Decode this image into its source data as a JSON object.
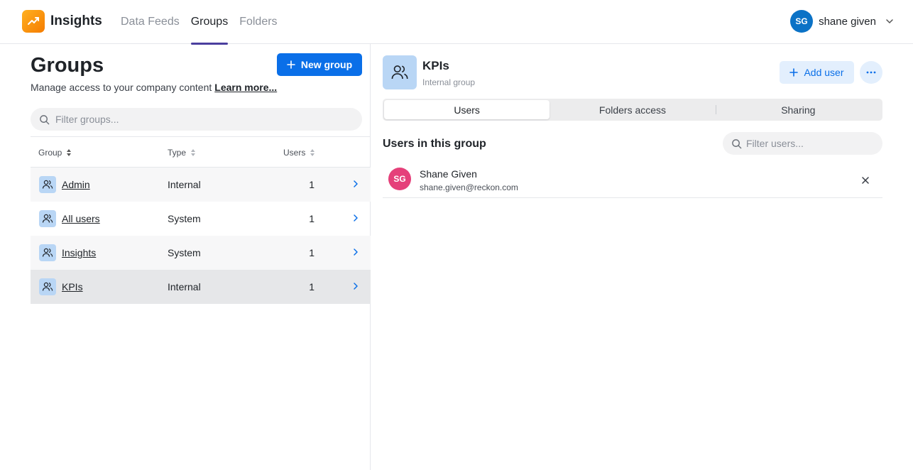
{
  "app": {
    "name": "Insights",
    "brand_color": "#f57c00"
  },
  "nav": {
    "tabs": [
      {
        "label": "Data Feeds"
      },
      {
        "label": "Groups",
        "active": true
      },
      {
        "label": "Folders"
      }
    ]
  },
  "user": {
    "initials": "SG",
    "name": "shane given"
  },
  "groups_page": {
    "title": "Groups",
    "subtitle": "Manage access to your company content",
    "learn_more": "Learn more...",
    "new_group_label": "New group",
    "filter_placeholder": "Filter groups...",
    "columns": {
      "group": "Group",
      "type": "Type",
      "users": "Users"
    },
    "rows": [
      {
        "name": "Admin",
        "type": "Internal",
        "users": "1"
      },
      {
        "name": "All users",
        "type": "System",
        "users": "1"
      },
      {
        "name": "Insights",
        "type": "System",
        "users": "1"
      },
      {
        "name": "KPIs",
        "type": "Internal",
        "users": "1",
        "selected": true
      }
    ]
  },
  "detail": {
    "title": "KPIs",
    "subtitle": "Internal group",
    "add_user_label": "Add user",
    "tabs": [
      {
        "label": "Users",
        "active": true
      },
      {
        "label": "Folders access"
      },
      {
        "label": "Sharing"
      }
    ],
    "section_title": "Users in this group",
    "filter_placeholder": "Filter users...",
    "members": [
      {
        "initials": "SG",
        "name": "Shane Given",
        "email": "shane.given@reckon.com"
      }
    ]
  }
}
